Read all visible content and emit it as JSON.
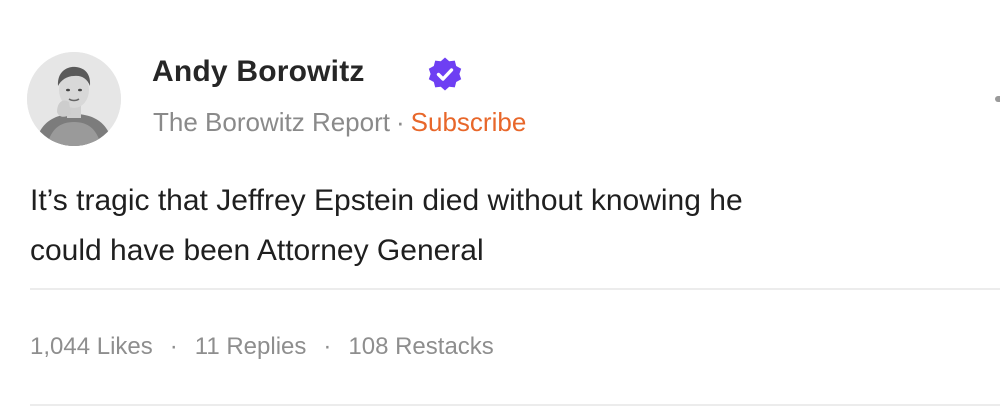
{
  "author": {
    "name": "Andy Borowitz",
    "verified_color": "#6e3ff3"
  },
  "publication": {
    "name": "The Borowitz Report",
    "separator": "·",
    "subscribe_label": "Subscribe",
    "subscribe_color": "#e8672a"
  },
  "note": {
    "text_line1": "It’s tragic that Jeffrey Epstein died without knowing he",
    "text_line2": "could have been Attorney General"
  },
  "stats": {
    "likes": "1,044 Likes",
    "replies": "11 Replies",
    "restacks": "108 Restacks",
    "separator": "·"
  },
  "icons": {
    "avatar": "author-avatar",
    "verified": "verified-badge-icon",
    "menu": "more-options-icon"
  }
}
